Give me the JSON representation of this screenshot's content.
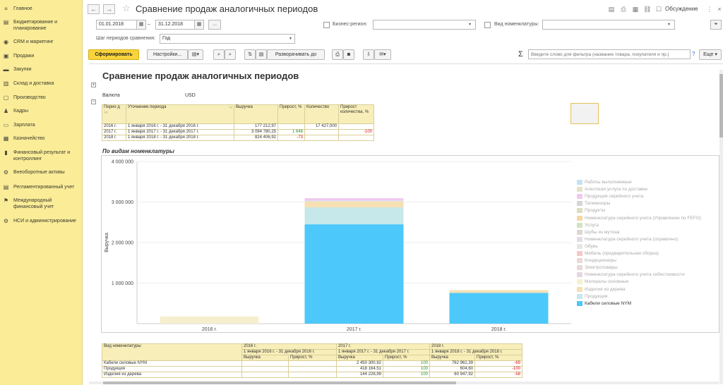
{
  "sidebar": {
    "items": [
      {
        "label": "Главное",
        "icon": "menu-icon"
      },
      {
        "label": "Бюджетирование и планирование",
        "icon": "budget-icon"
      },
      {
        "label": "CRM и маркетинг",
        "icon": "crm-icon"
      },
      {
        "label": "Продажи",
        "icon": "sales-icon"
      },
      {
        "label": "Закупки",
        "icon": "purchases-icon"
      },
      {
        "label": "Склад и доставка",
        "icon": "warehouse-icon"
      },
      {
        "label": "Производство",
        "icon": "production-icon"
      },
      {
        "label": "Кадры",
        "icon": "personnel-icon"
      },
      {
        "label": "Зарплата",
        "icon": "salary-icon"
      },
      {
        "label": "Казначейство",
        "icon": "treasury-icon"
      },
      {
        "label": "Финансовый результат и контроллинг",
        "icon": "finance-icon"
      },
      {
        "label": "Внеоборотные активы",
        "icon": "assets-icon"
      },
      {
        "label": "Регламентированный учет",
        "icon": "accounting-icon"
      },
      {
        "label": "Международный финансовый учет",
        "icon": "international-icon"
      },
      {
        "label": "НСИ и администрирование",
        "icon": "settings-icon"
      }
    ]
  },
  "header": {
    "back": "←",
    "forward": "→",
    "star": "☆",
    "title": "Сравнение продаж аналогичных периодов",
    "discuss_label": "Обсуждение"
  },
  "filters": {
    "date_from": "01.01.2018",
    "date_sep": "–",
    "date_to": "31.12.2018",
    "more": "...",
    "business_region_label": "Бизнес-регион:",
    "business_region_value": "",
    "nomenclature_kind_label": "Вид номенклатуры:",
    "nomenclature_kind_value": "",
    "step_label": "Шаг периодов сравнения:",
    "step_value": "Год"
  },
  "toolbar": {
    "generate": "Сформировать",
    "settings": "Настройки...",
    "expand": "Разворачивать до",
    "sigma": "Σ",
    "search_placeholder": "Введите слово для фильтра (название товара, покупателя и пр.)",
    "help": "?",
    "more": "Еще"
  },
  "report": {
    "heading": "Сравнение продаж аналогичных периодов",
    "currency_label": "Валюта",
    "currency_value": "USD",
    "summary": {
      "headers": [
        "Перио д",
        "Уточнение периода",
        "Выручка",
        "Прирост, %",
        "Количество",
        "Прирост количества, %"
      ],
      "rows": [
        [
          "2016 г.",
          "1 января 2016 г. - 31 декабря 2016 г.",
          "177 212,97",
          "",
          "17 427,000",
          ""
        ],
        [
          "2017 г.",
          "1 января 2017 г. - 31 декабря 2017 г.",
          "3 094 780,25",
          "1 646",
          "",
          "-100"
        ],
        [
          "2018 г.",
          "1 января 2018 г. - 31 декабря 2018 г.",
          "824 406,92",
          "-73",
          "",
          ""
        ]
      ]
    },
    "section_title": "По видам номенклатуры",
    "bottom_table": {
      "nomenclature_header": "Вид номенклатуры",
      "years": [
        "2016 г.",
        "2017 г.",
        "2018 г."
      ],
      "periods": [
        "1 января 2016 г. - 31 декабря 2016 г.",
        "1 января 2017 г. - 31 декабря 2017 г.",
        "1 января 2018 г. - 31 декабря 2018 г."
      ],
      "col_revenue": "Выручка",
      "col_growth": "Прирост, %",
      "rows": [
        {
          "name": "Кабели силовые NYM",
          "v2016": "",
          "g2016": "",
          "v2017": "2 450 300,92",
          "g2017": "100",
          "v2018": "762 962,39",
          "g2018": "-69"
        },
        {
          "name": "Продукция",
          "v2016": "",
          "g2016": "",
          "v2017": "418 164,51",
          "g2017": "100",
          "v2018": "604,60",
          "g2018": "-100"
        },
        {
          "name": "Изделия из дерева",
          "v2016": "",
          "g2016": "",
          "v2017": "144 228,99",
          "g2017": "100",
          "v2018": "60 947,92",
          "g2018": "-58"
        }
      ]
    }
  },
  "chart_data": {
    "type": "bar",
    "stacked": true,
    "ylabel": "Выручка",
    "ylim": [
      0,
      4000000
    ],
    "yticks": [
      "1 000 000",
      "2 000 000",
      "3 000 000",
      "4 000 000"
    ],
    "categories": [
      "2016 г.",
      "2017 г.",
      "2018 г."
    ],
    "series": [
      {
        "name": "Кабели силовые NYM",
        "color": "#4dc8fa",
        "values": [
          0,
          2450301,
          762962
        ]
      },
      {
        "name": "Продукция",
        "color": "#c7e8ea",
        "values": [
          0,
          418165,
          605
        ]
      },
      {
        "name": "Изделия из дерева",
        "color": "#f6e0b2",
        "values": [
          0,
          144229,
          60948
        ]
      },
      {
        "name": "Матералы основные",
        "color": "#f6efcf",
        "values": [
          177213,
          0,
          0
        ]
      },
      {
        "name": "Номенклатура серийного учета себестоимости",
        "color": "#e7d7de",
        "values": [
          0,
          0,
          0
        ]
      },
      {
        "name": "Электротовары",
        "color": "#e8d9d9",
        "values": [
          0,
          0,
          0
        ]
      },
      {
        "name": "Кондиционеры",
        "color": "#ead7d7",
        "values": [
          0,
          0,
          0
        ]
      },
      {
        "name": "Мебель (предварительная сборка)",
        "color": "#f2c9c9",
        "values": [
          0,
          0,
          0
        ]
      },
      {
        "name": "Обувь",
        "color": "#e6e6e6",
        "values": [
          0,
          0,
          0
        ]
      },
      {
        "name": "Номенклатура серийного учета (справочно)",
        "color": "#e3dbe8",
        "values": [
          0,
          30000,
          0
        ]
      },
      {
        "name": "Шубы из мутона",
        "color": "#ded7d1",
        "values": [
          0,
          0,
          0
        ]
      },
      {
        "name": "Услуга",
        "color": "#d2e4bf",
        "values": [
          0,
          0,
          0
        ]
      },
      {
        "name": "Номенклатура серийного учета (Управление по FEFO)",
        "color": "#f7d6a6",
        "values": [
          0,
          0,
          0
        ]
      },
      {
        "name": "Продукты",
        "color": "#dcdcc0",
        "values": [
          0,
          0,
          0
        ]
      },
      {
        "name": "Телевизоры",
        "color": "#d6d6d6",
        "values": [
          0,
          0,
          0
        ]
      },
      {
        "name": "Продукция серийного учета",
        "color": "#efc9ee",
        "values": [
          0,
          52085,
          0
        ]
      },
      {
        "name": "Агентская услуга по доставке",
        "color": "#e5e3c8",
        "values": [
          0,
          0,
          0
        ]
      },
      {
        "name": "Работы выполняемые",
        "color": "#c4e2f3",
        "values": [
          0,
          0,
          0
        ]
      }
    ]
  }
}
